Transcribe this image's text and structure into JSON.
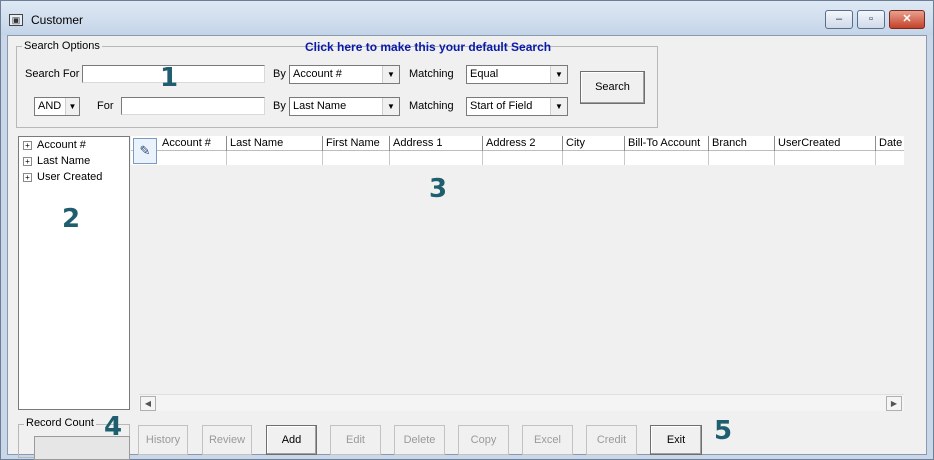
{
  "window": {
    "title": "Customer",
    "minimize_glyph": "–",
    "maximize_glyph": "▫",
    "close_glyph": "✕"
  },
  "search_options": {
    "legend": "Search Options",
    "default_link": "Click here to make this your default Search",
    "row1": {
      "label": "Search For",
      "value": "",
      "by_label": "By",
      "by_value": "Account #",
      "matching_label": "Matching",
      "matching_value": "Equal"
    },
    "row2": {
      "operator": "AND",
      "label": "For",
      "value": "",
      "by_label": "By",
      "by_value": "Last Name",
      "matching_label": "Matching",
      "matching_value": "Start of Field"
    },
    "search_button": "Search"
  },
  "tree": {
    "items": [
      {
        "label": "Account #"
      },
      {
        "label": "Last Name"
      },
      {
        "label": "User Created"
      }
    ],
    "expander_glyph": "+"
  },
  "grid": {
    "columns": [
      "Account #",
      "Last Name",
      "First Name",
      "Address 1",
      "Address 2",
      "City",
      "Bill-To Account",
      "Branch",
      "UserCreated",
      "Date"
    ]
  },
  "record_count": {
    "legend": "Record Count",
    "value": ""
  },
  "buttons": {
    "history": "History",
    "review": "Review",
    "add": "Add",
    "edit": "Edit",
    "delete": "Delete",
    "copy": "Copy",
    "excel": "Excel",
    "credit": "Credit",
    "exit": "Exit"
  },
  "markers": [
    "1",
    "2",
    "3",
    "4",
    "5"
  ]
}
